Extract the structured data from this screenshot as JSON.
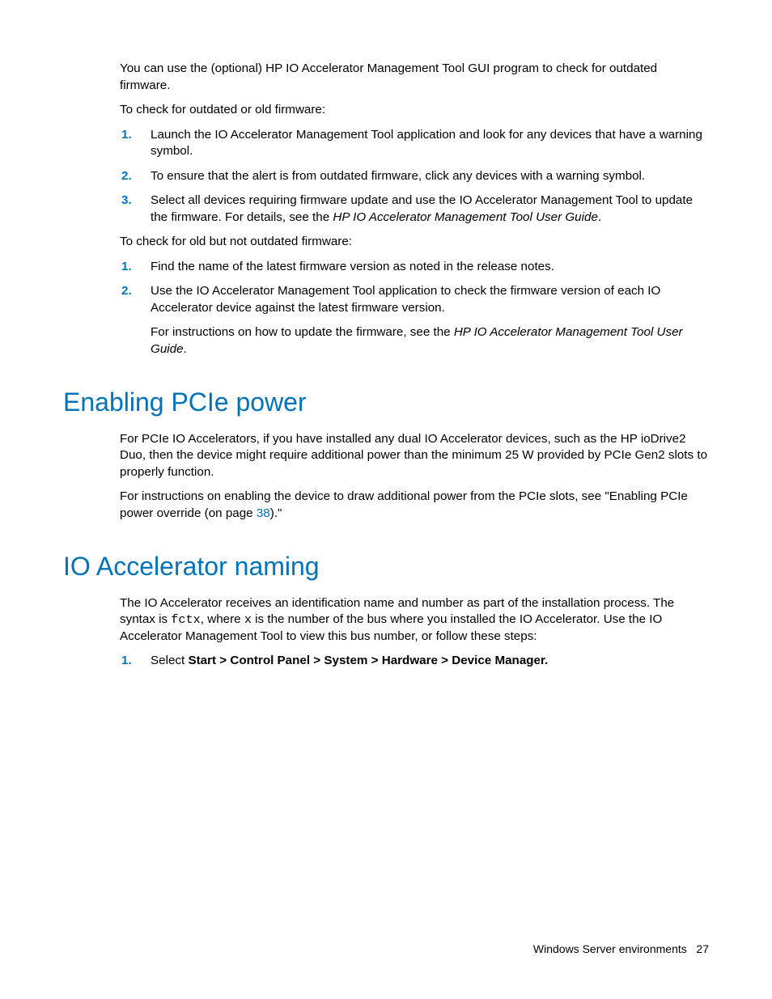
{
  "intro1": "You can use the (optional) HP IO Accelerator Management Tool GUI program to check for outdated firmware.",
  "intro2": "To check for outdated or old firmware:",
  "listA": {
    "n1": "1.",
    "t1": "Launch the IO Accelerator Management Tool application and look for any devices that have a warning symbol.",
    "n2": "2.",
    "t2": "To ensure that the alert is from outdated firmware, click any devices with a warning symbol.",
    "n3": "3.",
    "t3a": "Select all devices requiring firmware update and use the IO Accelerator Management Tool to update the firmware. For details, see the ",
    "t3em": "HP IO Accelerator Management Tool User Guide",
    "t3b": "."
  },
  "intro3": "To check for old but not outdated firmware:",
  "listB": {
    "n1": "1.",
    "t1": "Find the name of the latest firmware version as noted in the release notes.",
    "n2": "2.",
    "t2": "Use the IO Accelerator Management Tool application to check the firmware version of each IO Accelerator device against the latest firmware version.",
    "t2sub_a": "For instructions on how to update the firmware, see the ",
    "t2sub_em": "HP IO Accelerator Management Tool User Guide",
    "t2sub_b": "."
  },
  "h2a": "Enabling PCIe power",
  "pcie1": "For PCIe IO Accelerators, if you have installed any dual IO Accelerator devices, such as the HP ioDrive2 Duo, then the device might require additional power than the minimum 25 W provided by PCIe Gen2 slots to properly function.",
  "pcie2a": "For instructions on enabling the device to draw additional power from the PCIe slots, see \"Enabling PCIe power override (on page ",
  "pcie_link": "38",
  "pcie2b": ").\"",
  "h2b": "IO Accelerator naming",
  "naming1a": "The IO Accelerator receives an identification name and number as part of the installation process. The syntax is ",
  "naming_code1": "fctx",
  "naming1b": ", where ",
  "naming_code2": "x",
  "naming1c": " is the number of the bus where you installed the IO Accelerator. Use the IO Accelerator Management Tool to view this bus number, or follow these steps:",
  "listC": {
    "n1": "1.",
    "t1a": "Select ",
    "t1strong": "Start > Control Panel > System > Hardware > Device Manager."
  },
  "footer_text": "Windows Server environments",
  "footer_page": "27"
}
